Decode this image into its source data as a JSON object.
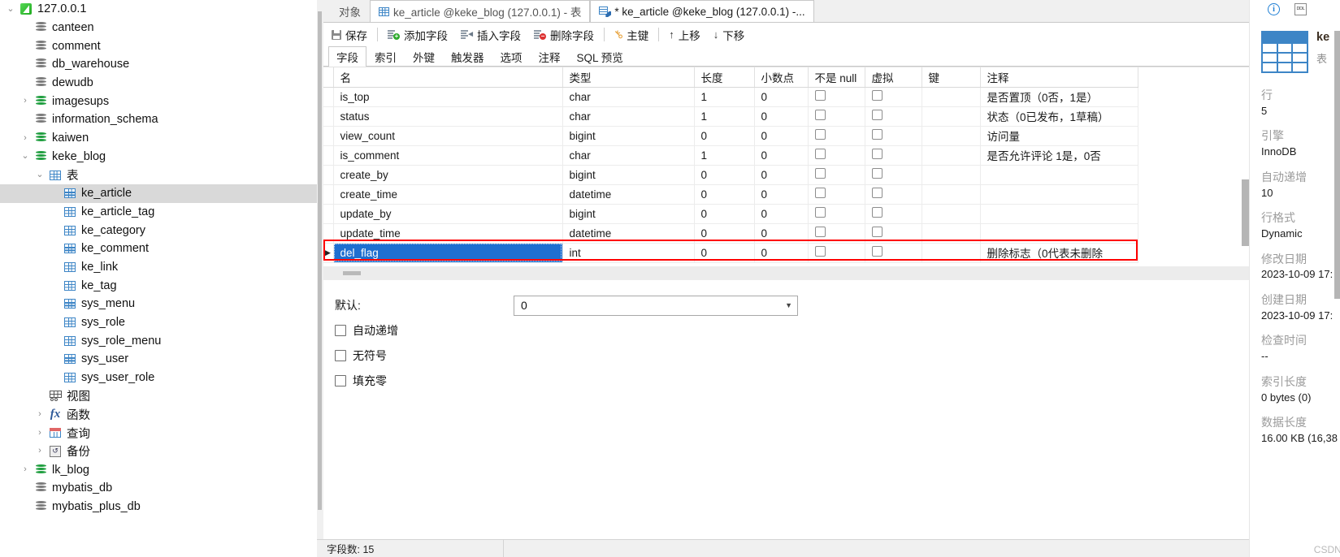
{
  "sidebar": {
    "nodes": [
      {
        "label": "127.0.0.1",
        "icon": "server-icon",
        "indent": 0,
        "twisty": "down",
        "selected": false
      },
      {
        "label": "canteen",
        "icon": "database-gray-icon",
        "indent": 1,
        "twisty": "none",
        "selected": false
      },
      {
        "label": "comment",
        "icon": "database-gray-icon",
        "indent": 1,
        "twisty": "none",
        "selected": false
      },
      {
        "label": "db_warehouse",
        "icon": "database-gray-icon",
        "indent": 1,
        "twisty": "none",
        "selected": false
      },
      {
        "label": "dewudb",
        "icon": "database-gray-icon",
        "indent": 1,
        "twisty": "none",
        "selected": false
      },
      {
        "label": "imagesups",
        "icon": "database-green-icon",
        "indent": 1,
        "twisty": "right",
        "selected": false
      },
      {
        "label": "information_schema",
        "icon": "database-gray-icon",
        "indent": 1,
        "twisty": "none",
        "selected": false
      },
      {
        "label": "kaiwen",
        "icon": "database-green-icon",
        "indent": 1,
        "twisty": "right",
        "selected": false
      },
      {
        "label": "keke_blog",
        "icon": "database-green-icon",
        "indent": 1,
        "twisty": "down",
        "selected": false
      },
      {
        "label": "表",
        "icon": "table-folder-icon",
        "indent": 2,
        "twisty": "down",
        "selected": false
      },
      {
        "label": "ke_article",
        "icon": "table-icon",
        "indent": 3,
        "twisty": "none",
        "selected": true
      },
      {
        "label": "ke_article_tag",
        "icon": "table-icon",
        "indent": 3,
        "twisty": "none",
        "selected": false
      },
      {
        "label": "ke_category",
        "icon": "table-icon",
        "indent": 3,
        "twisty": "none",
        "selected": false
      },
      {
        "label": "ke_comment",
        "icon": "table-icon",
        "indent": 3,
        "twisty": "none",
        "selected": false
      },
      {
        "label": "ke_link",
        "icon": "table-icon",
        "indent": 3,
        "twisty": "none",
        "selected": false
      },
      {
        "label": "ke_tag",
        "icon": "table-icon",
        "indent": 3,
        "twisty": "none",
        "selected": false
      },
      {
        "label": "sys_menu",
        "icon": "table-icon",
        "indent": 3,
        "twisty": "none",
        "selected": false
      },
      {
        "label": "sys_role",
        "icon": "table-icon",
        "indent": 3,
        "twisty": "none",
        "selected": false
      },
      {
        "label": "sys_role_menu",
        "icon": "table-icon",
        "indent": 3,
        "twisty": "none",
        "selected": false
      },
      {
        "label": "sys_user",
        "icon": "table-icon",
        "indent": 3,
        "twisty": "none",
        "selected": false
      },
      {
        "label": "sys_user_role",
        "icon": "table-icon",
        "indent": 3,
        "twisty": "none",
        "selected": false
      },
      {
        "label": "视图",
        "icon": "view-icon",
        "indent": 2,
        "twisty": "none",
        "selected": false
      },
      {
        "label": "函数",
        "icon": "function-icon",
        "indent": 2,
        "twisty": "right",
        "selected": false
      },
      {
        "label": "查询",
        "icon": "query-icon",
        "indent": 2,
        "twisty": "right",
        "selected": false
      },
      {
        "label": "备份",
        "icon": "backup-icon",
        "indent": 2,
        "twisty": "right",
        "selected": false
      },
      {
        "label": "lk_blog",
        "icon": "database-green-icon",
        "indent": 1,
        "twisty": "right",
        "selected": false
      },
      {
        "label": "mybatis_db",
        "icon": "database-gray-icon",
        "indent": 1,
        "twisty": "none",
        "selected": false
      },
      {
        "label": "mybatis_plus_db",
        "icon": "database-gray-icon",
        "indent": 1,
        "twisty": "none",
        "selected": false
      }
    ]
  },
  "tabs": {
    "object_label": "对象",
    "items": [
      {
        "label": "ke_article @keke_blog (127.0.0.1) - 表",
        "icon": "table-icon",
        "active": false
      },
      {
        "label": "* ke_article @keke_blog (127.0.0.1) -...",
        "icon": "table-edit-icon",
        "active": true
      }
    ]
  },
  "toolbar": {
    "save": "保存",
    "add_field": "添加字段",
    "insert_field": "插入字段",
    "delete_field": "删除字段",
    "primary_key": "主键",
    "move_up": "上移",
    "move_down": "下移"
  },
  "subtabs": [
    {
      "label": "字段",
      "active": true
    },
    {
      "label": "索引",
      "active": false
    },
    {
      "label": "外键",
      "active": false
    },
    {
      "label": "触发器",
      "active": false
    },
    {
      "label": "选项",
      "active": false
    },
    {
      "label": "注释",
      "active": false
    },
    {
      "label": "SQL 预览",
      "active": false
    }
  ],
  "grid": {
    "columns": [
      "名",
      "类型",
      "长度",
      "小数点",
      "不是 null",
      "虚拟",
      "键",
      "注释"
    ],
    "rows": [
      {
        "name": "is_top",
        "type": "char",
        "length": "1",
        "decimals": "0",
        "notnull": false,
        "virtual": false,
        "key": "",
        "comment": "是否置顶（0否，1是）",
        "selected": false
      },
      {
        "name": "status",
        "type": "char",
        "length": "1",
        "decimals": "0",
        "notnull": false,
        "virtual": false,
        "key": "",
        "comment": "状态（0已发布，1草稿）",
        "selected": false
      },
      {
        "name": "view_count",
        "type": "bigint",
        "length": "0",
        "decimals": "0",
        "notnull": false,
        "virtual": false,
        "key": "",
        "comment": "访问量",
        "selected": false
      },
      {
        "name": "is_comment",
        "type": "char",
        "length": "1",
        "decimals": "0",
        "notnull": false,
        "virtual": false,
        "key": "",
        "comment": "是否允许评论 1是，0否",
        "selected": false
      },
      {
        "name": "create_by",
        "type": "bigint",
        "length": "0",
        "decimals": "0",
        "notnull": false,
        "virtual": false,
        "key": "",
        "comment": "",
        "selected": false
      },
      {
        "name": "create_time",
        "type": "datetime",
        "length": "0",
        "decimals": "0",
        "notnull": false,
        "virtual": false,
        "key": "",
        "comment": "",
        "selected": false
      },
      {
        "name": "update_by",
        "type": "bigint",
        "length": "0",
        "decimals": "0",
        "notnull": false,
        "virtual": false,
        "key": "",
        "comment": "",
        "selected": false
      },
      {
        "name": "update_time",
        "type": "datetime",
        "length": "0",
        "decimals": "0",
        "notnull": false,
        "virtual": false,
        "key": "",
        "comment": "",
        "selected": false
      },
      {
        "name": "del_flag",
        "type": "int",
        "length": "0",
        "decimals": "0",
        "notnull": false,
        "virtual": false,
        "key": "",
        "comment": "删除标志（0代表未删除",
        "selected": true
      }
    ]
  },
  "form": {
    "default_label": "默认:",
    "default_value": "0",
    "auto_increment": "自动递增",
    "unsigned": "无符号",
    "zerofill": "填充零"
  },
  "statusbar": {
    "field_count": "字段数: 15",
    "right": ""
  },
  "info": {
    "title": "ke",
    "kind": "表",
    "props": [
      {
        "key": "行",
        "value": "5"
      },
      {
        "key": "引擎",
        "value": "InnoDB"
      },
      {
        "key": "自动递增",
        "value": "10"
      },
      {
        "key": "行格式",
        "value": "Dynamic"
      },
      {
        "key": "修改日期",
        "value": "2023-10-09 17:"
      },
      {
        "key": "创建日期",
        "value": "2023-10-09 17:"
      },
      {
        "key": "检查时间",
        "value": "--"
      },
      {
        "key": "索引长度",
        "value": "0 bytes (0)"
      },
      {
        "key": "数据长度",
        "value": "16.00 KB (16,38"
      }
    ]
  },
  "watermark": "CSDN @Bugman",
  "colors": {
    "selection_blue": "#1f6fd0",
    "highlight_red": "#ff0000",
    "accent_blue": "#3d85c6",
    "tree_selected": "#d9d9d9"
  }
}
